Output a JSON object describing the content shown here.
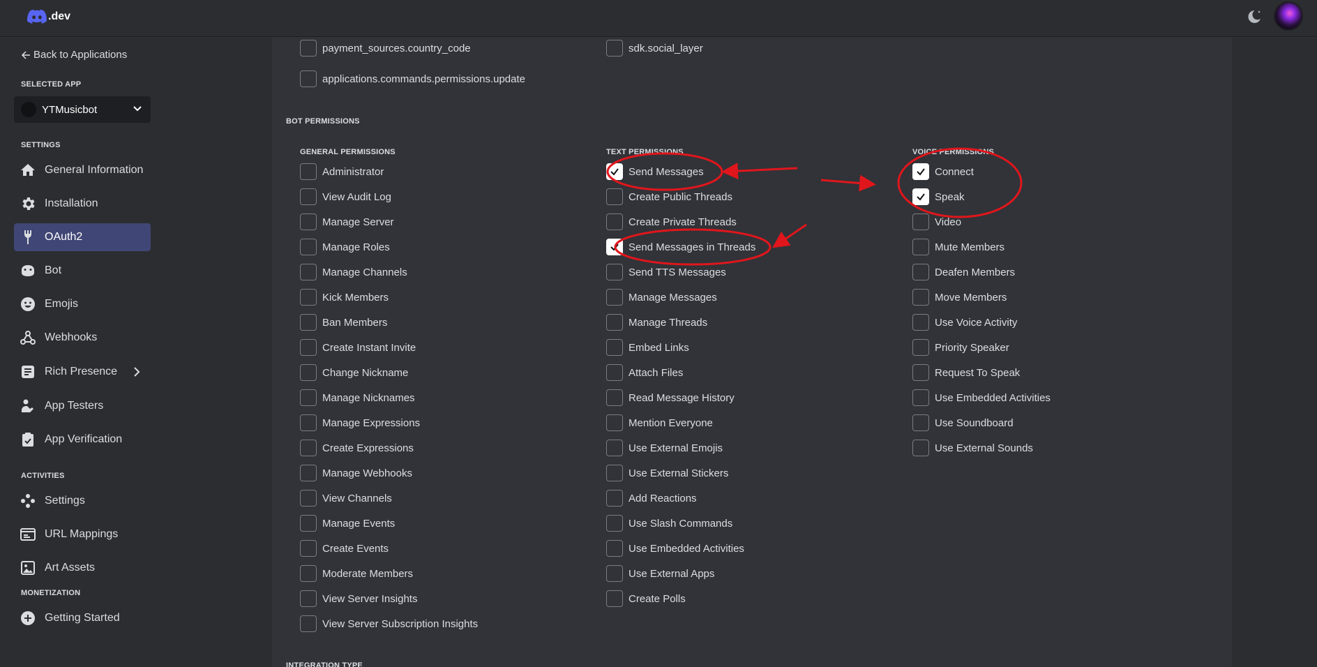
{
  "topbar": {
    "logo_text": ".dev",
    "icons": [
      "discord-logo-icon",
      "moon-icon",
      "avatar"
    ]
  },
  "sidebar": {
    "back_label": "Back to Applications",
    "selected_app_label": "SELECTED APP",
    "selected_app_name": "YTMusicbot",
    "settings_label": "SETTINGS",
    "settings_items": [
      {
        "label": "General Information",
        "icon": "home-icon"
      },
      {
        "label": "Installation",
        "icon": "gear-icon"
      },
      {
        "label": "OAuth2",
        "icon": "wrench-icon",
        "active": true
      },
      {
        "label": "Bot",
        "icon": "bot-icon"
      },
      {
        "label": "Emojis",
        "icon": "emoji-icon"
      },
      {
        "label": "Webhooks",
        "icon": "webhook-icon"
      },
      {
        "label": "Rich Presence",
        "icon": "rich-presence-icon"
      },
      {
        "label": "App Testers",
        "icon": "tester-icon"
      },
      {
        "label": "App Verification",
        "icon": "verification-icon"
      }
    ],
    "activities_label": "ACTIVITIES",
    "activities_items": [
      {
        "label": "Settings",
        "icon": "controller-icon"
      },
      {
        "label": "URL Mappings",
        "icon": "url-icon"
      },
      {
        "label": "Art Assets",
        "icon": "image-icon"
      }
    ],
    "monetization_label": "MONETIZATION",
    "monetization_items": [
      {
        "label": "Getting Started",
        "icon": "plus-circle-icon"
      }
    ]
  },
  "main": {
    "scopes_top": [
      {
        "label": "payment_sources.country_code",
        "checked": false
      },
      {
        "label": "sdk.social_layer",
        "checked": false
      },
      {
        "label": "applications.commands.permissions.update",
        "checked": false
      }
    ],
    "bot_permissions_title": "BOT PERMISSIONS",
    "general_title": "GENERAL PERMISSIONS",
    "text_title": "TEXT PERMISSIONS",
    "voice_title": "VOICE PERMISSIONS",
    "general": [
      {
        "label": "Administrator",
        "checked": false
      },
      {
        "label": "View Audit Log",
        "checked": false
      },
      {
        "label": "Manage Server",
        "checked": false
      },
      {
        "label": "Manage Roles",
        "checked": false
      },
      {
        "label": "Manage Channels",
        "checked": false
      },
      {
        "label": "Kick Members",
        "checked": false
      },
      {
        "label": "Ban Members",
        "checked": false
      },
      {
        "label": "Create Instant Invite",
        "checked": false
      },
      {
        "label": "Change Nickname",
        "checked": false
      },
      {
        "label": "Manage Nicknames",
        "checked": false
      },
      {
        "label": "Manage Expressions",
        "checked": false
      },
      {
        "label": "Create Expressions",
        "checked": false
      },
      {
        "label": "Manage Webhooks",
        "checked": false
      },
      {
        "label": "View Channels",
        "checked": false
      },
      {
        "label": "Manage Events",
        "checked": false
      },
      {
        "label": "Create Events",
        "checked": false
      },
      {
        "label": "Moderate Members",
        "checked": false
      },
      {
        "label": "View Server Insights",
        "checked": false
      },
      {
        "label": "View Server Subscription Insights",
        "checked": false
      }
    ],
    "text": [
      {
        "label": "Send Messages",
        "checked": true
      },
      {
        "label": "Create Public Threads",
        "checked": false
      },
      {
        "label": "Create Private Threads",
        "checked": false
      },
      {
        "label": "Send Messages in Threads",
        "checked": true
      },
      {
        "label": "Send TTS Messages",
        "checked": false
      },
      {
        "label": "Manage Messages",
        "checked": false
      },
      {
        "label": "Manage Threads",
        "checked": false
      },
      {
        "label": "Embed Links",
        "checked": false
      },
      {
        "label": "Attach Files",
        "checked": false
      },
      {
        "label": "Read Message History",
        "checked": false
      },
      {
        "label": "Mention Everyone",
        "checked": false
      },
      {
        "label": "Use External Emojis",
        "checked": false
      },
      {
        "label": "Use External Stickers",
        "checked": false
      },
      {
        "label": "Add Reactions",
        "checked": false
      },
      {
        "label": "Use Slash Commands",
        "checked": false
      },
      {
        "label": "Use Embedded Activities",
        "checked": false
      },
      {
        "label": "Use External Apps",
        "checked": false
      },
      {
        "label": "Create Polls",
        "checked": false
      }
    ],
    "voice": [
      {
        "label": "Connect",
        "checked": true
      },
      {
        "label": "Speak",
        "checked": true
      },
      {
        "label": "Video",
        "checked": false
      },
      {
        "label": "Mute Members",
        "checked": false
      },
      {
        "label": "Deafen Members",
        "checked": false
      },
      {
        "label": "Move Members",
        "checked": false
      },
      {
        "label": "Use Voice Activity",
        "checked": false
      },
      {
        "label": "Priority Speaker",
        "checked": false
      },
      {
        "label": "Request To Speak",
        "checked": false
      },
      {
        "label": "Use Embedded Activities",
        "checked": false
      },
      {
        "label": "Use Soundboard",
        "checked": false
      },
      {
        "label": "Use External Sounds",
        "checked": false
      }
    ],
    "integration_type_title": "INTEGRATION TYPE"
  },
  "colors": {
    "background": "#313338",
    "sidebar": "#2b2d31",
    "active_nav": "#404675",
    "annotation_red": "#e0161c"
  }
}
